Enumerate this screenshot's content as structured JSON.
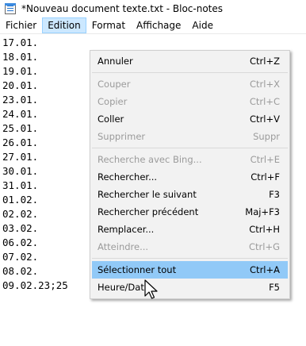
{
  "window": {
    "title": "*Nouveau document texte.txt - Bloc-notes"
  },
  "menubar": {
    "items": [
      "Fichier",
      "Edition",
      "Format",
      "Affichage",
      "Aide"
    ]
  },
  "editor": {
    "lines": [
      "17.01.",
      "18.01.",
      "19.01.",
      "20.01.",
      "23.01.",
      "24.01.",
      "25.01.",
      "26.01.",
      "27.01.",
      "30.01.",
      "31.01.",
      "01.02.",
      "02.02.",
      "03.02.",
      "06.02.",
      "07.02.",
      "08.02.",
      "09.02.23;25"
    ]
  },
  "edit_menu": {
    "items": [
      {
        "label": "Annuler",
        "shortcut": "Ctrl+Z",
        "disabled": false
      },
      {
        "label": "Couper",
        "shortcut": "Ctrl+X",
        "disabled": true
      },
      {
        "label": "Copier",
        "shortcut": "Ctrl+C",
        "disabled": true
      },
      {
        "label": "Coller",
        "shortcut": "Ctrl+V",
        "disabled": false
      },
      {
        "label": "Supprimer",
        "shortcut": "Suppr",
        "disabled": true
      },
      {
        "label": "Recherche avec Bing...",
        "shortcut": "Ctrl+E",
        "disabled": true
      },
      {
        "label": "Rechercher...",
        "shortcut": "Ctrl+F",
        "disabled": false
      },
      {
        "label": "Rechercher le suivant",
        "shortcut": "F3",
        "disabled": false
      },
      {
        "label": "Rechercher précédent",
        "shortcut": "Maj+F3",
        "disabled": false
      },
      {
        "label": "Remplacer...",
        "shortcut": "Ctrl+H",
        "disabled": false
      },
      {
        "label": "Atteindre...",
        "shortcut": "Ctrl+G",
        "disabled": true
      },
      {
        "label": "Sélectionner tout",
        "shortcut": "Ctrl+A",
        "disabled": false
      },
      {
        "label": "Heure/Date",
        "shortcut": "F5",
        "disabled": false
      }
    ]
  },
  "colors": {
    "menu_hover": "#91c9f7",
    "menubar_active": "#cce8ff",
    "disabled_text": "#9b9b9b"
  }
}
